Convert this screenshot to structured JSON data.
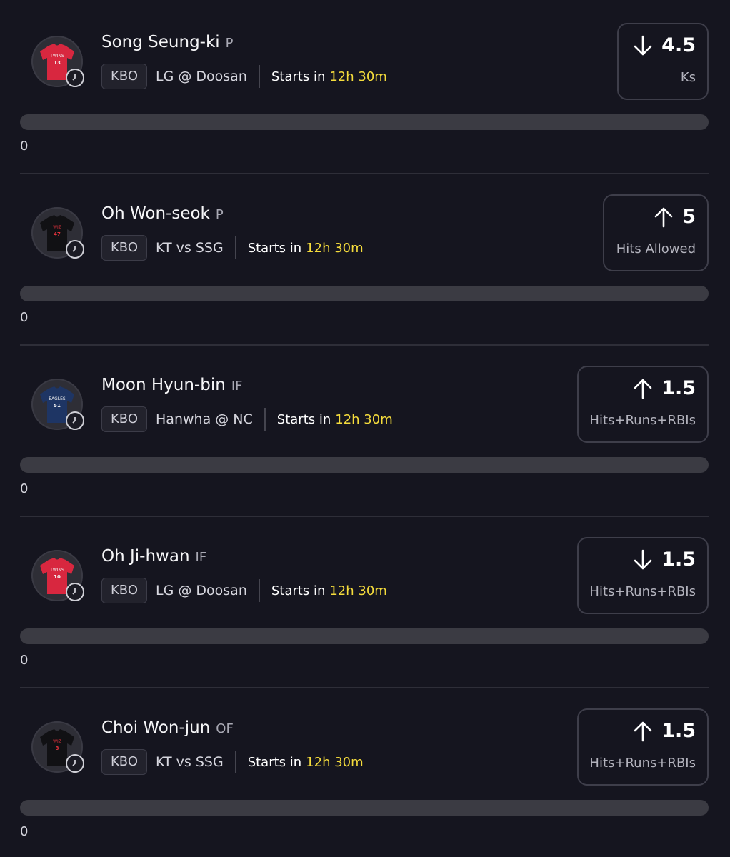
{
  "players": [
    {
      "name": "Song Seung-ki",
      "position": "P",
      "league": "KBO",
      "matchup": "LG @ Doosan",
      "starts_label": "Starts in",
      "starts_time": "12h 30m",
      "pick": "down",
      "line": "4.5",
      "stat": "Ks",
      "progress": "0",
      "jersey": {
        "text": "TWINS",
        "number": "13",
        "color": "#d8273f",
        "text_color": "#f2f2f2"
      }
    },
    {
      "name": "Oh Won-seok",
      "position": "P",
      "league": "KBO",
      "matchup": "KT vs SSG",
      "starts_label": "Starts in",
      "starts_time": "12h 30m",
      "pick": "up",
      "line": "5",
      "stat": "Hits Allowed",
      "progress": "0",
      "jersey": {
        "text": "WIZ",
        "number": "47",
        "color": "#111114",
        "text_color": "#e0323c"
      }
    },
    {
      "name": "Moon Hyun-bin",
      "position": "IF",
      "league": "KBO",
      "matchup": "Hanwha @ NC",
      "starts_label": "Starts in",
      "starts_time": "12h 30m",
      "pick": "up",
      "line": "1.5",
      "stat": "Hits+Runs+RBIs",
      "progress": "0",
      "jersey": {
        "text": "EAGLES",
        "number": "51",
        "color": "#1e3564",
        "text_color": "#f3f3f3"
      }
    },
    {
      "name": "Oh Ji-hwan",
      "position": "IF",
      "league": "KBO",
      "matchup": "LG @ Doosan",
      "starts_label": "Starts in",
      "starts_time": "12h 30m",
      "pick": "down",
      "line": "1.5",
      "stat": "Hits+Runs+RBIs",
      "progress": "0",
      "jersey": {
        "text": "TWINS",
        "number": "10",
        "color": "#d8273f",
        "text_color": "#f2f2f2"
      }
    },
    {
      "name": "Choi Won-jun",
      "position": "OF",
      "league": "KBO",
      "matchup": "KT vs SSG",
      "starts_label": "Starts in",
      "starts_time": "12h 30m",
      "pick": "up",
      "line": "1.5",
      "stat": "Hits+Runs+RBIs",
      "progress": "0",
      "jersey": {
        "text": "WIZ",
        "number": "3",
        "color": "#111114",
        "text_color": "#e0323c"
      }
    }
  ]
}
